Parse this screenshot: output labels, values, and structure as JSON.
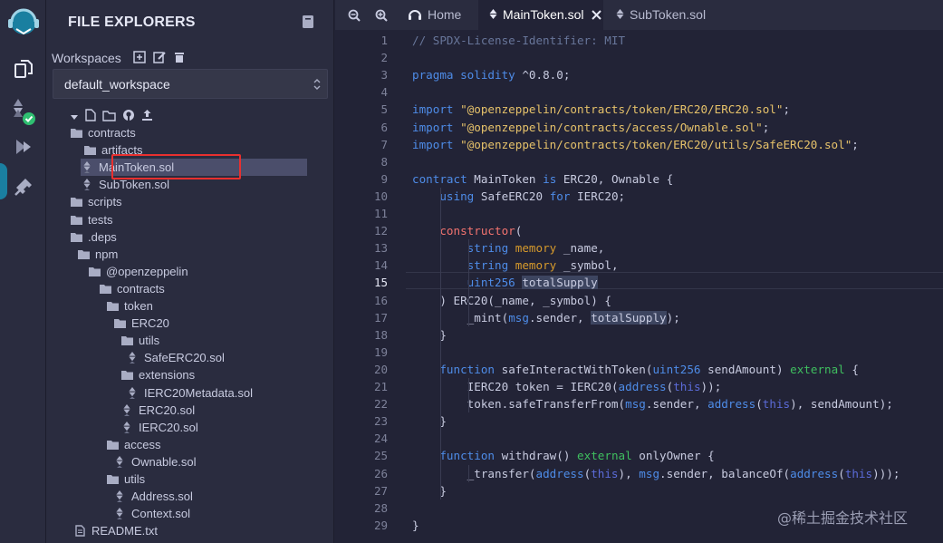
{
  "explorer": {
    "title": "FILE EXPLORERS",
    "workspaces_label": "Workspaces",
    "workspace_value": "default_workspace"
  },
  "tree": [
    {
      "label": "contracts",
      "type": "folder"
    },
    {
      "label": "artifacts",
      "type": "folder"
    },
    {
      "label": "MainToken.sol",
      "type": "sol",
      "selected": true
    },
    {
      "label": "SubToken.sol",
      "type": "sol"
    },
    {
      "label": "scripts",
      "type": "folder"
    },
    {
      "label": "tests",
      "type": "folder"
    },
    {
      "label": ".deps",
      "type": "folder"
    },
    {
      "label": "npm",
      "type": "folder"
    },
    {
      "label": "@openzeppelin",
      "type": "folder"
    },
    {
      "label": "contracts",
      "type": "folder"
    },
    {
      "label": "token",
      "type": "folder"
    },
    {
      "label": "ERC20",
      "type": "folder"
    },
    {
      "label": "utils",
      "type": "folder"
    },
    {
      "label": "SafeERC20.sol",
      "type": "sol"
    },
    {
      "label": "extensions",
      "type": "folder"
    },
    {
      "label": "IERC20Metadata.sol",
      "type": "sol"
    },
    {
      "label": "ERC20.sol",
      "type": "sol"
    },
    {
      "label": "IERC20.sol",
      "type": "sol"
    },
    {
      "label": "access",
      "type": "folder"
    },
    {
      "label": "Ownable.sol",
      "type": "sol"
    },
    {
      "label": "utils",
      "type": "folder"
    },
    {
      "label": "Address.sol",
      "type": "sol"
    },
    {
      "label": "Context.sol",
      "type": "sol"
    },
    {
      "label": "README.txt",
      "type": "txt"
    }
  ],
  "tabs": [
    {
      "label": "Home"
    },
    {
      "label": "MainToken.sol",
      "active": true
    },
    {
      "label": "SubToken.sol"
    }
  ],
  "editor": {
    "current_line": 15,
    "lines": [
      "// SPDX-License-Identifier: MIT",
      "",
      "pragma solidity ^0.8.0;",
      "",
      "import \"@openzeppelin/contracts/token/ERC20/ERC20.sol\";",
      "import \"@openzeppelin/contracts/access/Ownable.sol\";",
      "import \"@openzeppelin/contracts/token/ERC20/utils/SafeERC20.sol\";",
      "",
      "contract MainToken is ERC20, Ownable {",
      "    using SafeERC20 for IERC20;",
      "",
      "    constructor(",
      "        string memory _name,",
      "        string memory _symbol,",
      "        uint256 totalSupply",
      "    ) ERC20(_name, _symbol) {",
      "        _mint(msg.sender, totalSupply);",
      "    }",
      "",
      "    function safeInteractWithToken(uint256 sendAmount) external {",
      "        IERC20 token = IERC20(address(this));",
      "        token.safeTransferFrom(msg.sender, address(this), sendAmount);",
      "    }",
      "",
      "    function withdraw() external onlyOwner {",
      "        _transfer(address(this), msg.sender, balanceOf(address(this)));",
      "    }",
      "",
      "}"
    ]
  },
  "watermark": "@稀土掘金技术社区",
  "colors": {
    "accent": "#1a7fa0",
    "highlight_box": "#e8302f",
    "check": "#2fbf71"
  }
}
